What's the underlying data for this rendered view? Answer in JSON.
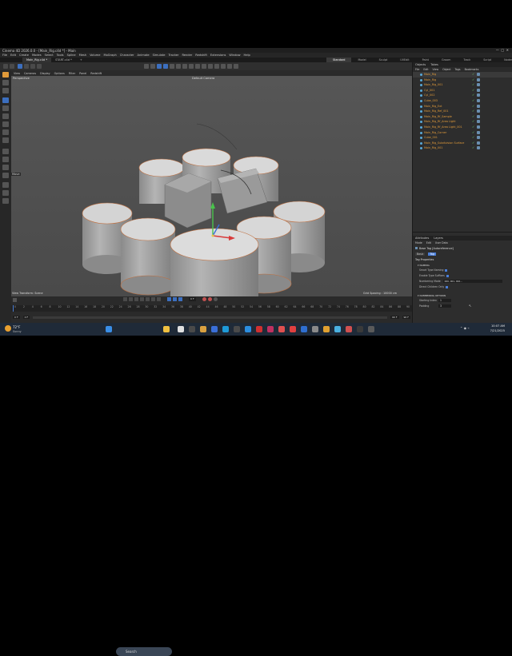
{
  "window": {
    "title": "Cinema 4D 2026.0.0 - [Main_Rig.c4d *] - Main"
  },
  "menu": [
    "File",
    "Edit",
    "Create",
    "Modes",
    "Select",
    "Tools",
    "Spline",
    "Mesh",
    "Volume",
    "MoGraph",
    "Character",
    "Animate",
    "Simulate",
    "Tracker",
    "Render",
    "Redshift",
    "Extensions",
    "Window",
    "Help"
  ],
  "doc_tabs": [
    {
      "label": "Main_Rig.c4d *"
    },
    {
      "label": "START.c4d *"
    }
  ],
  "layouts": [
    "Standard",
    "Model",
    "Sculpt",
    "UVEdit",
    "Paint",
    "Groom",
    "Track",
    "Script",
    "Nodes"
  ],
  "viewport": {
    "menu": [
      "View",
      "Cameras",
      "Display",
      "Options",
      "Filter",
      "Panel",
      "Redshift"
    ],
    "label": "Perspective",
    "camera": "Default Camera",
    "move_hint": "Move",
    "status_left": "View Transform: Scene",
    "grid_spacing": "Grid Spacing : 10000 cm"
  },
  "timeline": {
    "ticks": [
      "0",
      "2",
      "4",
      "6",
      "8",
      "10",
      "12",
      "14",
      "16",
      "18",
      "20",
      "22",
      "24",
      "26",
      "28",
      "30",
      "32",
      "34",
      "36",
      "38",
      "40",
      "42",
      "44",
      "46",
      "48",
      "50",
      "52",
      "54",
      "56",
      "58",
      "60",
      "62",
      "64",
      "66",
      "68",
      "70",
      "72",
      "74",
      "76",
      "78",
      "80",
      "82",
      "84",
      "86",
      "88",
      "90"
    ],
    "start": "0 F",
    "current": "0 F",
    "current2": "0 F",
    "end": "90 F",
    "end2": "90 F"
  },
  "objects_panel": {
    "tabs": [
      "Objects",
      "Takes"
    ],
    "menu": [
      "File",
      "Edit",
      "View",
      "Object",
      "Tags",
      "Bookmarks"
    ],
    "items": [
      {
        "name": "Main_Rig",
        "color": "#e09a3a"
      },
      {
        "name": "Main_Rig",
        "color": "#e09a3a"
      },
      {
        "name": "Main_Rig_001",
        "color": "#e09a3a"
      },
      {
        "name": "Cyl_001",
        "color": "#e09a3a"
      },
      {
        "name": "Cyl_002",
        "color": "#e09a3a"
      },
      {
        "name": "Cube_003",
        "color": "#e09a3a"
      },
      {
        "name": "Main_Rig_Ext",
        "color": "#e09a3a"
      },
      {
        "name": "Main_Rig_Ref_001",
        "color": "#e09a3a"
      },
      {
        "name": "Main_Rig_Rf_Sample",
        "color": "#e09a3a"
      },
      {
        "name": "Main_Rig_Rf_Area Light",
        "color": "#e09a3a"
      },
      {
        "name": "Main_Rig_Rf_Area Light_001",
        "color": "#e09a3a"
      },
      {
        "name": "Main_Rig_Corner",
        "color": "#e09a3a"
      },
      {
        "name": "Cube_001",
        "color": "#e09a3a"
      },
      {
        "name": "Main_Rig_Subdivision Surface",
        "color": "#e09a3a"
      },
      {
        "name": "Main_Rig_001",
        "color": "#e09a3a"
      }
    ]
  },
  "attributes": {
    "tabs": [
      "Attributes",
      "Layers"
    ],
    "menu": [
      "Mode",
      "Edit",
      "User Data"
    ],
    "title": "Base Tag [Autoreference]",
    "subtabs": [
      "Basic",
      "Tag"
    ],
    "section": "Tag Properties",
    "naming_header": "NAMING",
    "props": [
      {
        "label": "Smart Type Naming",
        "type": "check"
      },
      {
        "label": "Enable Type Suffixes",
        "type": "check"
      },
      {
        "label": "Numbering Mode",
        "type": "field",
        "value": "000, 001, 002..."
      },
      {
        "label": "Direct Children Only",
        "type": "check"
      }
    ],
    "numbering_header": "NUMBERING OPTIONS",
    "numbering": [
      {
        "label": "Starting Index",
        "value": "1"
      },
      {
        "label": "Padding",
        "value": "3"
      }
    ]
  },
  "taskbar": {
    "weather_temp": "72°F",
    "weather_desc": "Sunny",
    "search": "Search",
    "time": "10:07 AM",
    "date": "7/21/2025"
  }
}
